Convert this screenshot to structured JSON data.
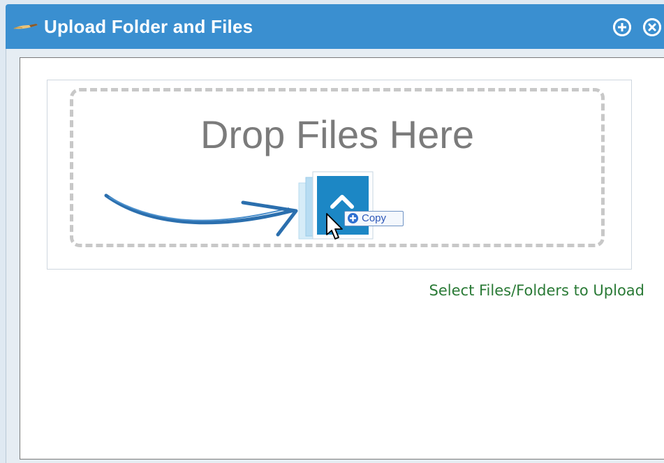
{
  "window": {
    "title": "Upload Folder and Files",
    "title_icon": "brush-icon",
    "buttons": [
      {
        "name": "restore-icon",
        "label": ""
      },
      {
        "name": "close-icon",
        "label": ""
      }
    ],
    "titlebar_color": "#3a8fd0"
  },
  "drop_zone": {
    "title": "Drop Files Here",
    "tooltip_label": "Copy",
    "graphic": "upload-file-stack-icon"
  },
  "actions": {
    "select_label": "Select Files/Folders to Upload",
    "link_color": "#2a7a36"
  }
}
